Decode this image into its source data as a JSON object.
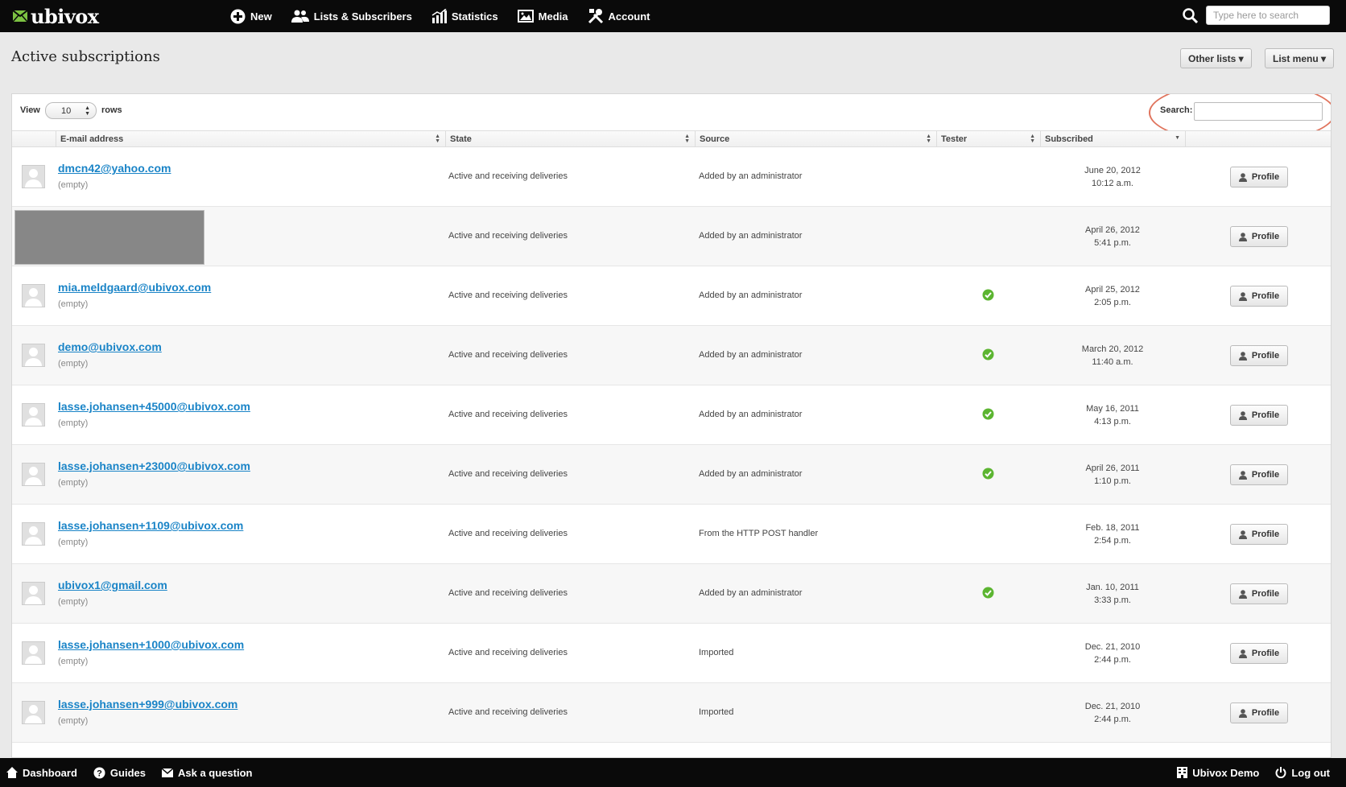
{
  "app": {
    "logo_text": "ubivox",
    "nav": [
      {
        "label": "New",
        "icon": "plus-circle-icon"
      },
      {
        "label": "Lists & Subscribers",
        "icon": "users-icon"
      },
      {
        "label": "Statistics",
        "icon": "bar-chart-icon"
      },
      {
        "label": "Media",
        "icon": "image-icon"
      },
      {
        "label": "Account",
        "icon": "tools-icon"
      }
    ],
    "search_placeholder": "Type here to search"
  },
  "page": {
    "title": "Active subscriptions",
    "other_lists_label": "Other lists ▾",
    "list_menu_label": "List menu ▾"
  },
  "controls": {
    "view_label": "View",
    "rows_value": "10",
    "rows_label": "rows",
    "search_label": "Search:"
  },
  "table": {
    "columns": [
      "E-mail address",
      "State",
      "Source",
      "Tester",
      "Subscribed"
    ],
    "profile_label": "Profile",
    "rows": [
      {
        "email": "dmcn42@yahoo.com",
        "sub": "(empty)",
        "state": "Active and receiving deliveries",
        "source": "Added by an administrator",
        "tester": false,
        "date": "June 20, 2012",
        "time": "10:12 a.m.",
        "redacted": false
      },
      {
        "email": "",
        "sub": "",
        "state": "Active and receiving deliveries",
        "source": "Added by an administrator",
        "tester": false,
        "date": "April 26, 2012",
        "time": "5:41 p.m.",
        "redacted": true
      },
      {
        "email": "mia.meldgaard@ubivox.com",
        "sub": "(empty)",
        "state": "Active and receiving deliveries",
        "source": "Added by an administrator",
        "tester": true,
        "date": "April 25, 2012",
        "time": "2:05 p.m.",
        "redacted": false
      },
      {
        "email": "demo@ubivox.com",
        "sub": "(empty)",
        "state": "Active and receiving deliveries",
        "source": "Added by an administrator",
        "tester": true,
        "date": "March 20, 2012",
        "time": "11:40 a.m.",
        "redacted": false
      },
      {
        "email": "lasse.johansen+45000@ubivox.com",
        "sub": "(empty)",
        "state": "Active and receiving deliveries",
        "source": "Added by an administrator",
        "tester": true,
        "date": "May 16, 2011",
        "time": "4:13 p.m.",
        "redacted": false
      },
      {
        "email": "lasse.johansen+23000@ubivox.com",
        "sub": "(empty)",
        "state": "Active and receiving deliveries",
        "source": "Added by an administrator",
        "tester": true,
        "date": "April 26, 2011",
        "time": "1:10 p.m.",
        "redacted": false
      },
      {
        "email": "lasse.johansen+1109@ubivox.com",
        "sub": "(empty)",
        "state": "Active and receiving deliveries",
        "source": "From the HTTP POST handler",
        "tester": false,
        "date": "Feb. 18, 2011",
        "time": "2:54 p.m.",
        "redacted": false
      },
      {
        "email": "ubivox1@gmail.com",
        "sub": "(empty)",
        "state": "Active and receiving deliveries",
        "source": "Added by an administrator",
        "tester": true,
        "date": "Jan. 10, 2011",
        "time": "3:33 p.m.",
        "redacted": false
      },
      {
        "email": "lasse.johansen+1000@ubivox.com",
        "sub": "(empty)",
        "state": "Active and receiving deliveries",
        "source": "Imported",
        "tester": false,
        "date": "Dec. 21, 2010",
        "time": "2:44 p.m.",
        "redacted": false
      },
      {
        "email": "lasse.johansen+999@ubivox.com",
        "sub": "(empty)",
        "state": "Active and receiving deliveries",
        "source": "Imported",
        "tester": false,
        "date": "Dec. 21, 2010",
        "time": "2:44 p.m.",
        "redacted": false
      }
    ]
  },
  "footer": {
    "dashboard": "Dashboard",
    "guides": "Guides",
    "ask": "Ask a question",
    "user": "Ubivox Demo",
    "logout": "Log out"
  },
  "colors": {
    "link": "#1a84c7",
    "tester_check": "#5cb531",
    "highlight": "#e0735c",
    "logo_mark": "#7cc242"
  }
}
